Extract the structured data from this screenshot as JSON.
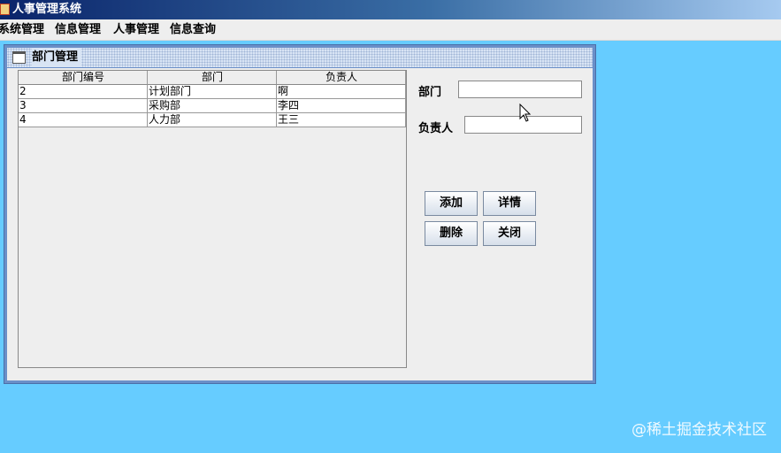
{
  "window": {
    "title": "人事管理系统"
  },
  "menu": [
    "系统管理",
    "信息管理",
    "人事管理",
    "信息查询"
  ],
  "frame": {
    "title": "部门管理"
  },
  "table": {
    "columns": [
      "部门编号",
      "部门",
      "负责人"
    ],
    "rows": [
      [
        "2",
        "计划部门",
        "啊"
      ],
      [
        "3",
        "采购部",
        "李四"
      ],
      [
        "4",
        "人力部",
        "王三"
      ]
    ]
  },
  "form": {
    "dept_label": "部门",
    "dept_value": "",
    "manager_label": "负责人",
    "manager_value": ""
  },
  "buttons": {
    "add": "添加",
    "detail": "详情",
    "delete": "删除",
    "close": "关闭"
  },
  "watermark": "@稀土掘金技术社区"
}
